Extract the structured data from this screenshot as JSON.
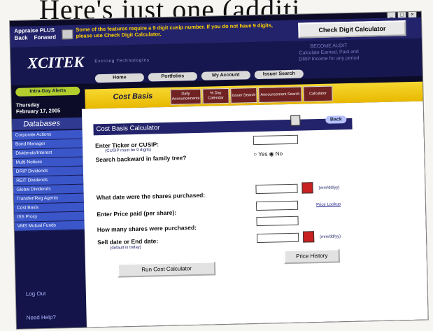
{
  "book": {
    "caption": "Here's just one (additi"
  },
  "window": {
    "app_title": "Appraise PLUS",
    "back_label": "Back",
    "forward_label": "Forward",
    "notice": "Some of the features require a 9 digit cusip number. If you do not have 9 digits, please use Check Digit Calculator.",
    "check_digit_label": "Check Digit Calculator"
  },
  "header": {
    "logo": "XCITEK",
    "tagline": "Exciting Technologies",
    "promo": "BECOME AUDIT\nCalculate Earned, Paid and\nDRIP Income for any period"
  },
  "tabs": [
    "Home",
    "Portfolios",
    "My Account",
    "Issuer Search"
  ],
  "sidebar": {
    "intraday": "Intra-Day Alerts",
    "date_line1": "Thursday",
    "date_line2": "February 17, 2005",
    "databases_label": "Databases",
    "items": [
      "Corporate Actions",
      "Bond Manager",
      "Dividends/Interest",
      "Multi-Notices",
      "DRIP Dividends",
      "REIT Dividends",
      "Global Dividends",
      "Transfer/Reg Agents",
      "Cost Basis",
      "ISS Proxy",
      "VMS Mutual Funds"
    ],
    "logout": "Log Out",
    "help": "Need Help?"
  },
  "band": {
    "title": "Cost Basis",
    "subtabs": [
      "Daily Announcements",
      "% Day Calendar",
      "Issuer Search",
      "Announcement Search",
      "Calculator"
    ]
  },
  "calculator": {
    "title": "Cost Basis Calculator",
    "back_label": "Back",
    "ticker_label": "Enter Ticker or CUSIP:",
    "ticker_hint": "(CUSIP must be 9 digits)",
    "family_label": "Search backward in family tree?",
    "yes_label": "Yes",
    "no_label": "No",
    "date_purchased_label": "What date were the shares purchased:",
    "date_format": "(mm/dd/yy)",
    "price_label": "Enter Price paid (per share):",
    "price_link": "Price Lookup",
    "shares_label": "How many shares were purchased:",
    "sell_label": "Sell date or End date:",
    "sell_hint": "(default is today)",
    "price_history_label": "Price History",
    "run_label": "Run Cost Calculator"
  }
}
